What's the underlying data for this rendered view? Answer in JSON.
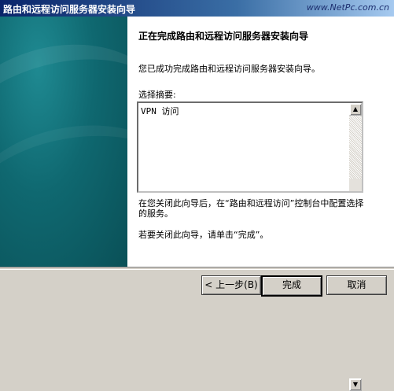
{
  "window": {
    "title": "路由和远程访问服务器安装向导",
    "watermark": "www.NetPc.com.cn"
  },
  "content": {
    "heading": "正在完成路由和远程访问服务器安装向导",
    "intro": "您已成功完成路由和远程访问服务器安装向导。",
    "summary_label": "选择摘要:",
    "summary_items": [
      "VPN 访问"
    ],
    "note_configure": "在您关闭此向导后，在“路由和远程访问”控制台中配置选择的服务。",
    "note_close": "若要关闭此向导，请单击“完成”。"
  },
  "buttons": {
    "back": "< 上一步(B)",
    "finish": "完成",
    "cancel": "取消"
  },
  "colors": {
    "title_bar": "#0a246a",
    "side_panel": "#0f6870",
    "dialog_face": "#d4d0c8"
  }
}
